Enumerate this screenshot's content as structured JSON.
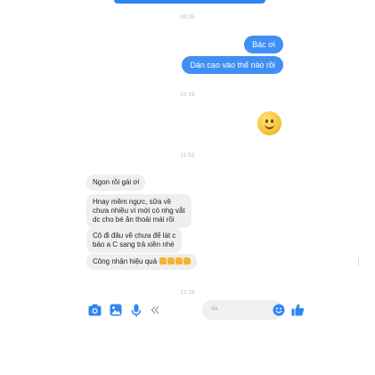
{
  "timestamps": [
    "09:05",
    "10:19",
    "11:52",
    "12:19"
  ],
  "outgoing_messages": [
    {
      "text": "Bác ơi"
    },
    {
      "text": "Dán cao vào thế nào rồi"
    }
  ],
  "reaction": {
    "icon": "smiling-face-emoji"
  },
  "incoming_messages": [
    {
      "lines": [
        "Ngon rồi gái ơi"
      ]
    },
    {
      "lines": [
        "Hnay mềm ngực, sữa về",
        "chưa nhiều vì mới có nhg vắt",
        "dc cho bé ăn thoải mái rồi"
      ]
    },
    {
      "lines": [
        "Cô đi đâu về chưa để lát c",
        "bảo a C sang trả xiền nhé"
      ]
    },
    {
      "lines": [
        "Công nhận hiệu quả"
      ],
      "trailing_icons": [
        "thumbs-up-icon",
        "thumbs-up-icon",
        "thumbs-up-icon",
        "thumbs-up-icon"
      ]
    }
  ],
  "composer": {
    "placeholder": "Aa",
    "icons": [
      "camera-icon",
      "image-icon",
      "microphone-icon",
      "chevron-left-icon",
      "emoji-icon",
      "like-icon"
    ]
  },
  "colors": {
    "accent": "#2d86f2",
    "incoming_bubble": "#efefef",
    "timestamp": "#b8b8b8"
  }
}
